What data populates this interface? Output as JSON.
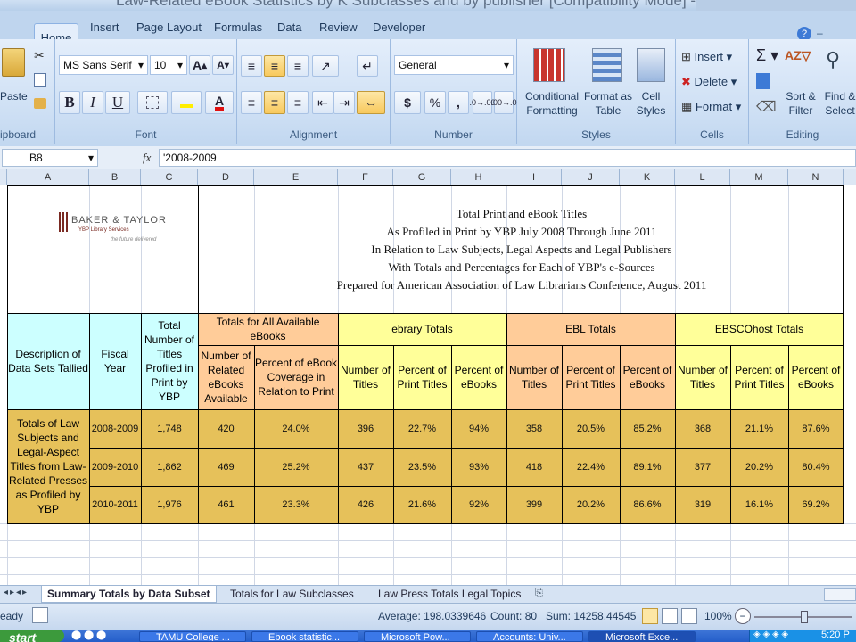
{
  "window": {
    "title": "Law-Related eBook Statistics by K Subclasses and by publisher  [Compatibility Mode]  - Micr"
  },
  "ribbon": {
    "tabs": [
      "Home",
      "Insert",
      "Page Layout",
      "Formulas",
      "Data",
      "Review",
      "Developer"
    ],
    "active_tab": "Home",
    "clipboard": {
      "paste": "Paste",
      "label": "ipboard"
    },
    "font": {
      "name": "MS Sans Serif",
      "size": "10",
      "bold": "B",
      "italic": "I",
      "underline": "U",
      "label": "Font"
    },
    "alignment": {
      "label": "Alignment"
    },
    "number": {
      "format": "General",
      "currency": "$",
      "percent": "%",
      "comma": ",",
      "inc_dec": ".0→.00",
      "dec_dec": ".00→.0",
      "label": "Number"
    },
    "styles": {
      "conditional": [
        "Conditional",
        "Formatting"
      ],
      "format_table": [
        "Format as",
        "Table"
      ],
      "cell_styles": [
        "Cell",
        "Styles"
      ],
      "label": "Styles"
    },
    "cells": {
      "insert": "Insert",
      "delete": "Delete",
      "format": "Format",
      "label": "Cells"
    },
    "editing": {
      "sort": [
        "Sort &",
        "Filter"
      ],
      "find": [
        "Find &",
        "Select"
      ],
      "label": "Editing"
    }
  },
  "formula_bar": {
    "name_box": "B8",
    "fx": "fx",
    "content": "'2008-2009"
  },
  "columns": [
    "A",
    "B",
    "C",
    "D",
    "E",
    "F",
    "G",
    "H",
    "I",
    "J",
    "K",
    "L",
    "M",
    "N"
  ],
  "sheet": {
    "logo": {
      "company": "BAKER & TAYLOR",
      "sub": "YBP Library Services",
      "tagline": "the future delivered"
    },
    "header_lines": [
      "Total Print and eBook Titles",
      "As Profiled in Print by YBP July 2008 Through June 2011",
      "In Relation to Law Subjects, Legal Aspects and Legal Publishers",
      "With Totals and Percentages for Each of YBP's e-Sources",
      "Prepared for American Association of Law Librarians Conference,  August 2011"
    ],
    "col_heads": {
      "desc": "Description of Data Sets Tallied",
      "year": "Fiscal Year",
      "total": "Total Number of Titles Profiled in Print by YBP",
      "all": "Totals for All Available eBooks",
      "ebrary": "ebrary Totals",
      "ebl": "EBL Totals",
      "ebsco": "EBSCOhost Totals",
      "num_related": "Number of Related eBooks Available",
      "pct_coverage": "Percent of eBook Coverage in Relation to Print",
      "num_titles": "Number of Titles",
      "pct_print": "Percent of Print Titles",
      "pct_ebooks": "Percent of eBooks"
    },
    "row_label": "Totals of Law Subjects and Legal-Aspect Titles from Law-Related Presses as Profiled by YBP",
    "rows": [
      [
        "2008-2009",
        "1,748",
        "420",
        "24.0%",
        "396",
        "22.7%",
        "94%",
        "358",
        "20.5%",
        "85.2%",
        "368",
        "21.1%",
        "87.6%"
      ],
      [
        "2009-2010",
        "1,862",
        "469",
        "25.2%",
        "437",
        "23.5%",
        "93%",
        "418",
        "22.4%",
        "89.1%",
        "377",
        "20.2%",
        "80.4%"
      ],
      [
        "2010-2011",
        "1,976",
        "461",
        "23.3%",
        "426",
        "21.6%",
        "92%",
        "399",
        "20.2%",
        "86.6%",
        "319",
        "16.1%",
        "69.2%"
      ]
    ]
  },
  "sheet_tabs": [
    "Summary Totals by Data Subset",
    "Totals for Law Subclasses",
    "Law Press Totals Legal Topics"
  ],
  "status": {
    "ready": "eady",
    "average": "Average: 198.0339646",
    "count": "Count: 80",
    "sum": "Sum: 14258.44545",
    "zoom": "100%"
  },
  "taskbar": {
    "start": "start",
    "items": [
      "TAMU College ...",
      "Ebook statistic...",
      "Microsoft Pow...",
      "Accounts: Univ...",
      "Microsoft Exce..."
    ],
    "clock": "5:20 P"
  },
  "colors": {
    "blue": "#ccffff",
    "orange": "#ffcc99",
    "yellow": "#ffff99",
    "gold": "#e6c15a"
  }
}
